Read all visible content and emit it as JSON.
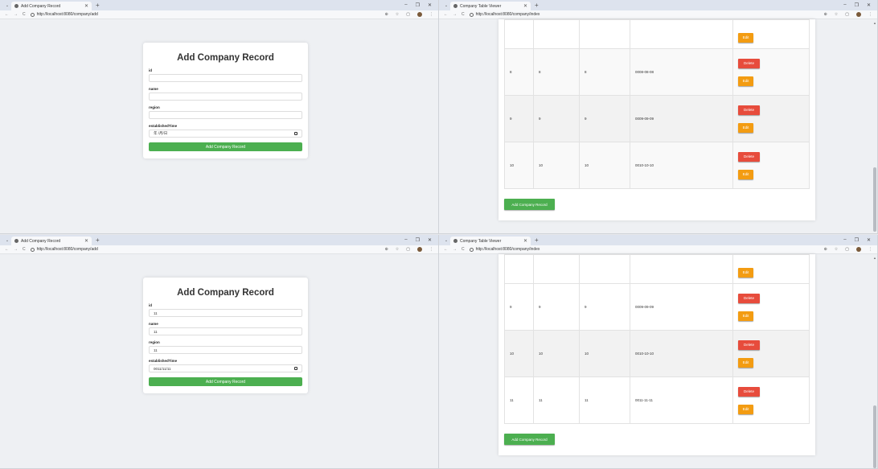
{
  "windows": [
    {
      "tab_title": "Add Company Record",
      "url": "http://localhost:8080/company/add",
      "form": {
        "title": "Add Company Record",
        "fields": [
          {
            "label": "id",
            "value": ""
          },
          {
            "label": "name",
            "value": ""
          },
          {
            "label": "region",
            "value": ""
          },
          {
            "label": "establishedTime",
            "value": "年 /月/日"
          }
        ],
        "submit_label": "Add Company Record"
      }
    },
    {
      "tab_title": "Company Table Viewer",
      "url": "http://localhost:8080/company/index",
      "rows": [
        {
          "c1": "",
          "c2": "",
          "c3": "",
          "c4": "",
          "edit_only": true
        },
        {
          "c1": "8",
          "c2": "8",
          "c3": "8",
          "c4": "0008-08-08"
        },
        {
          "c1": "9",
          "c2": "9",
          "c3": "9",
          "c4": "0009-09-09"
        },
        {
          "c1": "10",
          "c2": "10",
          "c3": "10",
          "c4": "0010-10-10"
        }
      ],
      "delete_label": "Delete",
      "edit_label": "Edit",
      "add_label": "Add Company Record"
    },
    {
      "tab_title": "Add Company Record",
      "url": "http://localhost:8080/company/add",
      "form": {
        "title": "Add Company Record",
        "fields": [
          {
            "label": "id",
            "value": "11"
          },
          {
            "label": "name",
            "value": "11"
          },
          {
            "label": "region",
            "value": "11"
          },
          {
            "label": "establishedTime",
            "value": "0011/11/11"
          }
        ],
        "submit_label": "Add Company Record"
      }
    },
    {
      "tab_title": "Company Table Viewer",
      "url": "http://localhost:8080/company/index",
      "rows": [
        {
          "c1": "",
          "c2": "",
          "c3": "",
          "c4": "",
          "edit_only": true
        },
        {
          "c1": "9",
          "c2": "9",
          "c3": "9",
          "c4": "0009-09-09"
        },
        {
          "c1": "10",
          "c2": "10",
          "c3": "10",
          "c4": "0010-10-10"
        },
        {
          "c1": "11",
          "c2": "11",
          "c3": "11",
          "c4": "0011-11-11"
        }
      ],
      "delete_label": "Delete",
      "edit_label": "Edit",
      "add_label": "Add Company Record"
    }
  ],
  "icons": {
    "back": "←",
    "forward": "→",
    "reload": "C",
    "zoom": "⊕",
    "star": "☆",
    "ext": "▢",
    "menu": "⋮",
    "minimize": "–",
    "restore": "❐",
    "close": "✕",
    "newtab": "+",
    "tabmenu": "⌄"
  }
}
